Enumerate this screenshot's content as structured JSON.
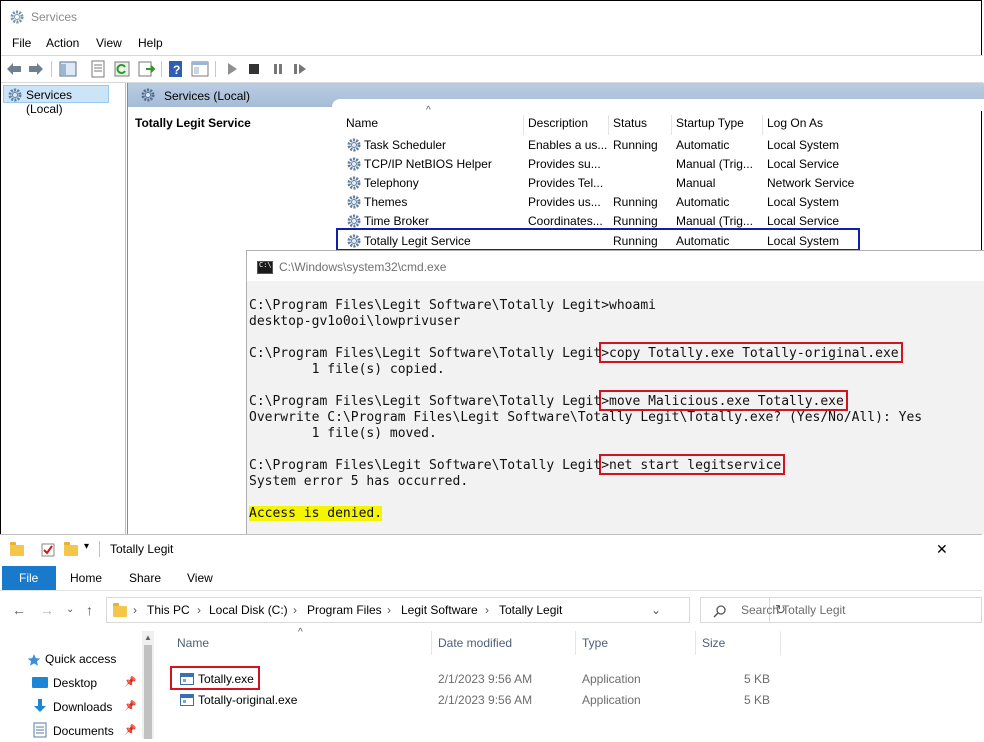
{
  "services_window": {
    "title": "Services",
    "menu": [
      "File",
      "Action",
      "View",
      "Help"
    ],
    "tree_item": "Services (Local)",
    "header_title": "Services (Local)",
    "selected_service_name": "Totally Legit Service",
    "columns": [
      "Name",
      "Description",
      "Status",
      "Startup Type",
      "Log On As"
    ],
    "rows": [
      {
        "name": "Task Scheduler",
        "description": "Enables a us...",
        "status": "Running",
        "startup": "Automatic",
        "logon": "Local System"
      },
      {
        "name": "TCP/IP NetBIOS Helper",
        "description": "Provides su...",
        "status": "",
        "startup": "Manual (Trig...",
        "logon": "Local Service"
      },
      {
        "name": "Telephony",
        "description": "Provides Tel...",
        "status": "",
        "startup": "Manual",
        "logon": "Network Service"
      },
      {
        "name": "Themes",
        "description": "Provides us...",
        "status": "Running",
        "startup": "Automatic",
        "logon": "Local System"
      },
      {
        "name": "Time Broker",
        "description": "Coordinates...",
        "status": "Running",
        "startup": "Manual (Trig...",
        "logon": "Local Service"
      },
      {
        "name": "Totally Legit Service",
        "description": "",
        "status": "Running",
        "startup": "Automatic",
        "logon": "Local System"
      }
    ]
  },
  "cmd_window": {
    "title": "C:\\Windows\\system32\\cmd.exe",
    "prompt": "C:\\Program Files\\Legit Software\\Totally Legit>",
    "lines": [
      {
        "cmd": "whoami"
      },
      {
        "out": "desktop-gv1o0oi\\lowprivuser"
      },
      {
        "cmd": "copy Totally.exe Totally-original.exe"
      },
      {
        "out": "        1 file(s) copied."
      },
      {
        "cmd": "move Malicious.exe Totally.exe"
      },
      {
        "out": "Overwrite C:\\Program Files\\Legit Software\\Totally Legit\\Totally.exe? (Yes/No/All): Yes"
      },
      {
        "out": "        1 file(s) moved."
      },
      {
        "cmd": "net start legitservice"
      },
      {
        "out": "System error 5 has occurred."
      },
      {
        "out": "Access is denied."
      }
    ]
  },
  "explorer_window": {
    "title": "Totally Legit",
    "ribbon_tabs": [
      "File",
      "Home",
      "Share",
      "View"
    ],
    "breadcrumb": [
      "This PC",
      "Local Disk (C:)",
      "Program Files",
      "Legit Software",
      "Totally Legit"
    ],
    "search_placeholder": "Search Totally Legit",
    "nav_items": [
      "Quick access",
      "Desktop",
      "Downloads",
      "Documents"
    ],
    "columns": [
      "Name",
      "Date modified",
      "Type",
      "Size"
    ],
    "files": [
      {
        "name": "Totally.exe",
        "date": "2/1/2023 9:56 AM",
        "type": "Application",
        "size": "5 KB"
      },
      {
        "name": "Totally-original.exe",
        "date": "2/1/2023 9:56 AM",
        "type": "Application",
        "size": "5 KB"
      }
    ]
  },
  "colors": {
    "highlight_red": "#d2141e",
    "selection_blue": "#1020a8",
    "denied_yellow": "#f5f500",
    "file_tab_blue": "#1979ca"
  }
}
